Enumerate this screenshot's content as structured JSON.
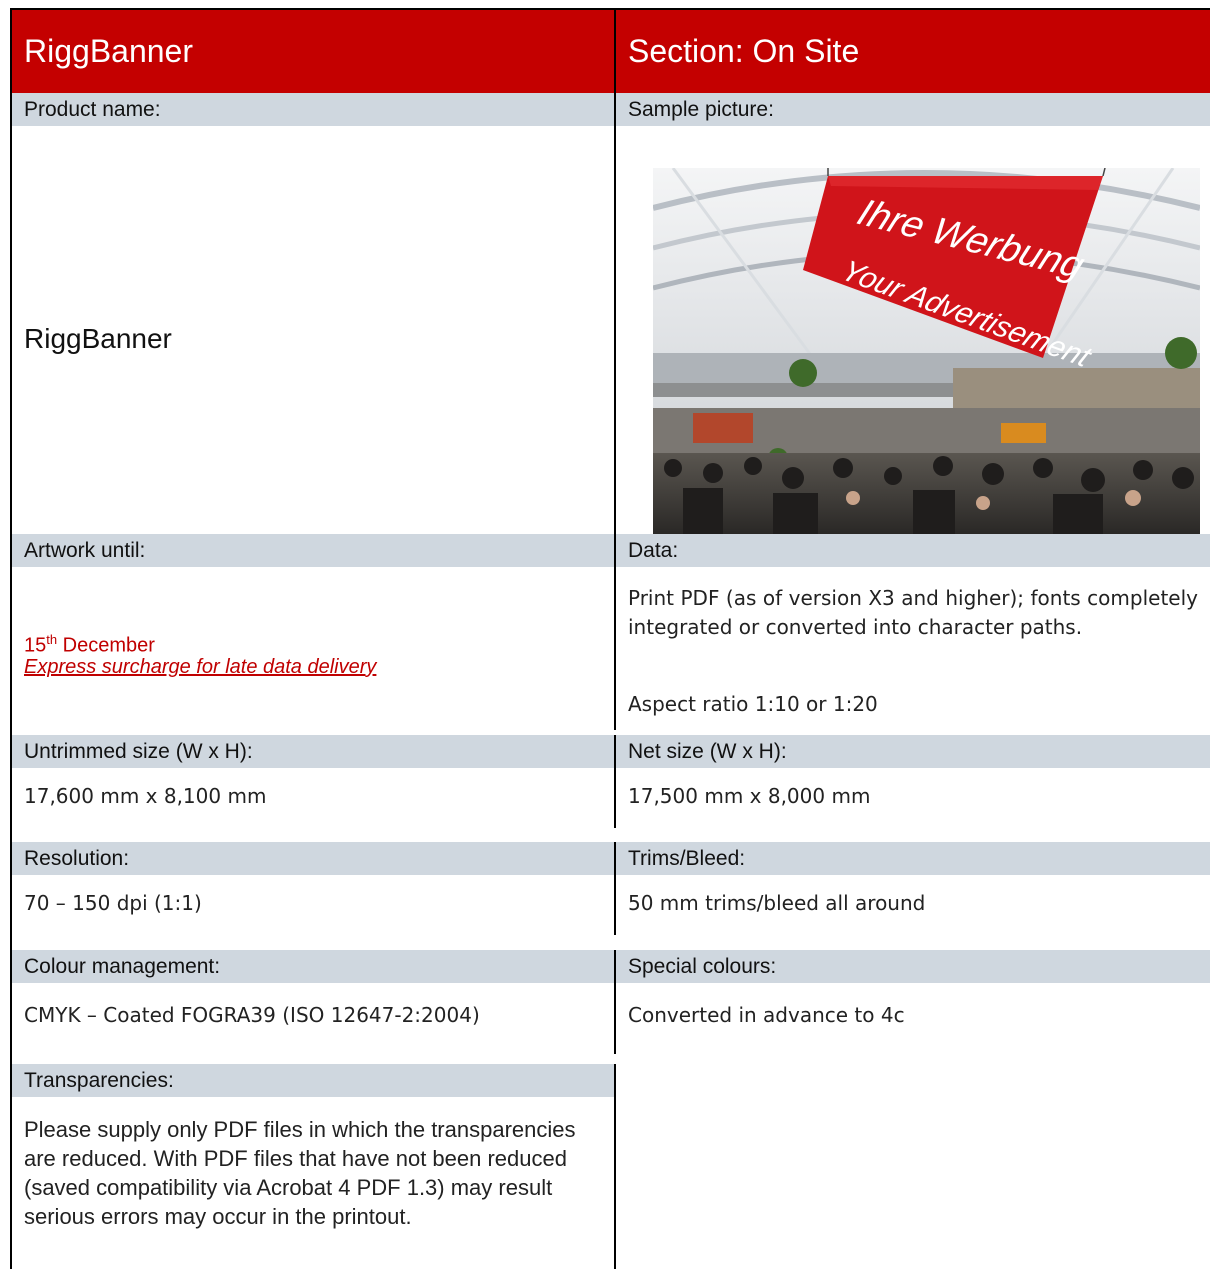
{
  "header": {
    "left_title": "RiggBanner",
    "right_title": "Section: On Site"
  },
  "product": {
    "label": "Product name:",
    "value": "RiggBanner"
  },
  "sample": {
    "label": "Sample picture:",
    "banner_line1": "Ihre Werbung",
    "banner_line2": "Your Advertisement"
  },
  "artwork": {
    "label": "Artwork until:",
    "date_day": "15",
    "date_suffix": "th",
    "date_month": " December",
    "link": "Express surcharge for late data delivery"
  },
  "data": {
    "label": "Data:",
    "line1": "Print PDF (as of version X3 and higher); fonts completely integrated or converted into character paths.",
    "line2": "Aspect ratio 1:10 or 1:20"
  },
  "untrimmed": {
    "label": "Untrimmed size (W x H):",
    "value": "17,600 mm x 8,100 mm"
  },
  "net": {
    "label": "Net size (W x H):",
    "value": "17,500 mm x 8,000 mm"
  },
  "resolution": {
    "label": "Resolution:",
    "value": "70 – 150 dpi (1:1)"
  },
  "trims": {
    "label": "Trims/Bleed:",
    "value": "50 mm trims/bleed all around"
  },
  "colour": {
    "label": "Colour management:",
    "value": "CMYK – Coated FOGRA39 (ISO 12647-2:2004)"
  },
  "special": {
    "label": "Special colours:",
    "value": "Converted in advance to 4c"
  },
  "transparencies": {
    "label": "Transparencies:",
    "value": "Please supply only PDF files in which the transparencies are reduced. With PDF files that have not been reduced (saved compatibility via Acrobat 4 PDF 1.3) may result serious errors may occur in the printout."
  },
  "colors": {
    "brand_red": "#c40000",
    "header_grey": "#cfd7df",
    "text_red": "#c00000"
  }
}
